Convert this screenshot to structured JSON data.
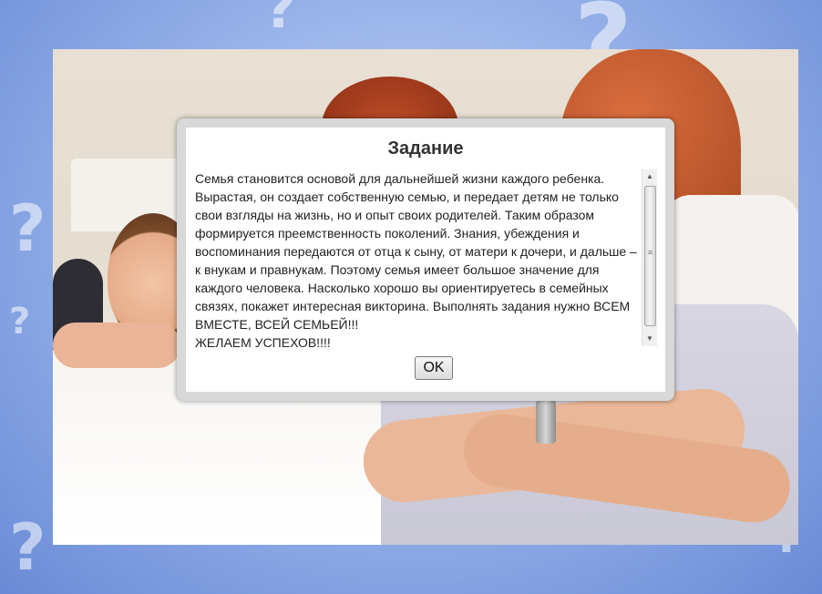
{
  "background": {
    "accent": "#8fa9e6",
    "glyphs": [
      "?",
      "?",
      "?",
      "?",
      "?",
      "?"
    ]
  },
  "dialog": {
    "title": "Задание",
    "text": "Семья становится основой для дальнейшей жизни каждого ребенка. Вырастая, он создает собственную семью, и передает детям не только свои взгляды на жизнь, но и опыт своих родителей. Таким образом формируется преемственность поколений. Знания, убеждения и воспоминания передаются от отца к сыну, от матери к дочери, и дальше – к внукам и правнукам. Поэтому семья имеет большое значение для каждого человека. Насколько хорошо вы ориентируетесь в семейных связях, покажет интересная викторина. Выполнять задания нужно ВСЕМ ВМЕСТЕ, ВСЕЙ СЕМЬЕЙ!!!",
    "text_last_line": "ЖЕЛАЕМ УСПЕХОВ!!!!",
    "ok_label": "OK"
  },
  "scrollbar": {
    "up_icon": "▲",
    "down_icon": "▼",
    "grip_icon": "≡"
  }
}
